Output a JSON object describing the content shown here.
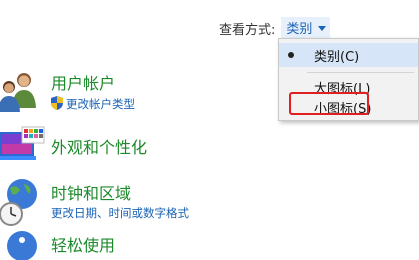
{
  "view_by": {
    "label": "查看方式:",
    "selected": "类别",
    "menu": {
      "items": [
        {
          "label": "类别(C)",
          "checked": true
        },
        {
          "label": "大图标(L)",
          "checked": false
        },
        {
          "label": "小图标(S)",
          "checked": false
        }
      ]
    }
  },
  "categories": [
    {
      "title": "用户帐户",
      "links": [
        "更改帐户类型"
      ],
      "icon": "users-icon"
    },
    {
      "title": "外观和个性化",
      "links": [],
      "icon": "appearance-icon"
    },
    {
      "title": "时钟和区域",
      "links": [
        "更改日期、时间或数字格式"
      ],
      "icon": "clock-globe-icon"
    },
    {
      "title": "轻松使用",
      "links": [],
      "icon": "ease-of-access-icon"
    }
  ],
  "colors": {
    "category_title": "#1c8a2a",
    "link": "#1a63b5",
    "highlight": "#e02020",
    "menu_selected": "#d6e6f8"
  }
}
